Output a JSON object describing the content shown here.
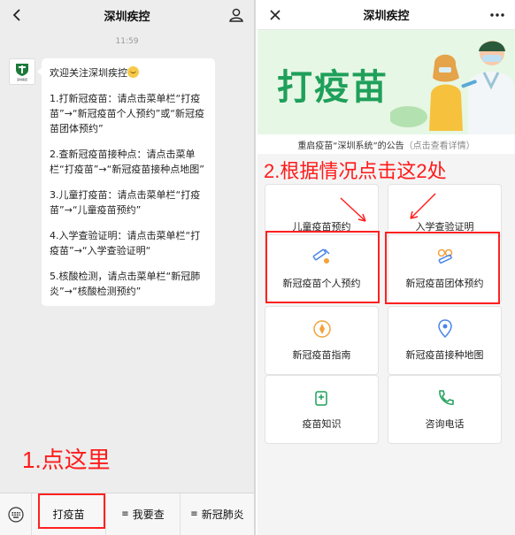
{
  "left_panel": {
    "title": "深圳疾控",
    "time": "11:59",
    "avatar_label": "深圳疾控",
    "message": {
      "greeting": "欢迎关注深圳疾控",
      "p1": "1.打新冠疫苗：请点击菜单栏“打疫苗”→“新冠疫苗个人预约”或“新冠疫苗团体预约”",
      "p2": "2.查新冠疫苗接种点：请点击菜单栏“打疫苗”→“新冠疫苗接种点地图”",
      "p3": "3.儿童打疫苗：请点击菜单栏“打疫苗”→“儿童疫苗预约”",
      "p4": "4.入学查验证明：请点击菜单栏“打疫苗”→“入学查验证明“",
      "p5": "5.核酸检测，请点击菜单栏“新冠肺炎”→“核酸检测预约”"
    },
    "annotation": "1.点这里",
    "menu": {
      "item1": "打疫苗",
      "item2": "我要查",
      "item3": "新冠肺炎"
    }
  },
  "right_panel": {
    "title": "深圳疾控",
    "banner_title": "打疫苗",
    "notice_text": "重启疫苗“深圳系统”的公告",
    "notice_detail": "（点击查看详情）",
    "annotation": "2.根据情况点击这2处",
    "cards": {
      "c1": "儿童疫苗预约",
      "c2": "入学查验证明",
      "c3": "新冠疫苗个人预约",
      "c4": "新冠疫苗团体预约",
      "c5": "新冠疫苗指南",
      "c6": "新冠疫苗接种地图",
      "c7": "疫苗知识",
      "c8": "咨询电话"
    }
  },
  "colors": {
    "accent_green": "#1fa05a",
    "annotation_red": "#ff1a1a",
    "icon_orange": "#f3a23b",
    "icon_blue": "#4a86e8"
  }
}
